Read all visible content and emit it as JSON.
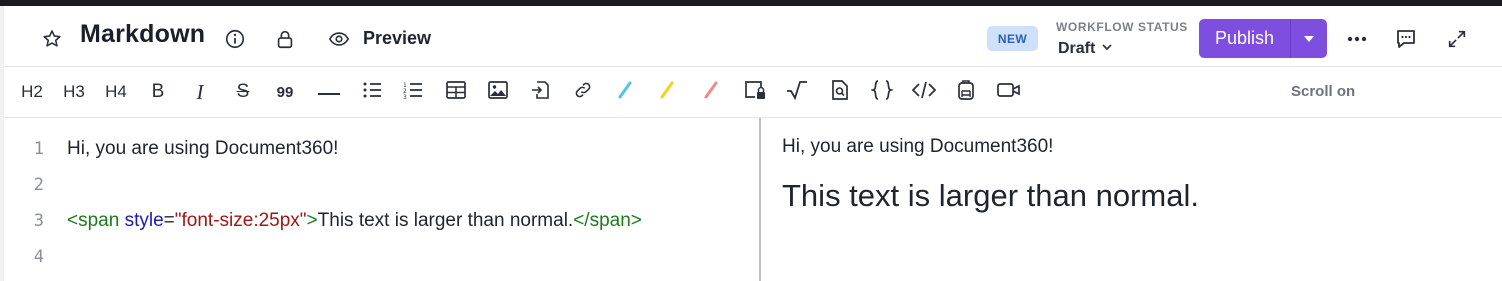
{
  "header": {
    "title": "Markdown",
    "preview_label": "Preview",
    "new_badge": "NEW",
    "workflow_status_label": "WORKFLOW STATUS",
    "workflow_status_value": "Draft",
    "publish_label": "Publish",
    "icons": [
      "star-icon",
      "info-icon",
      "lock-icon",
      "eye-icon",
      "chevron-down-icon",
      "more-icon",
      "comment-icon",
      "expand-icon"
    ]
  },
  "toolbar": {
    "h2": "H2",
    "h3": "H3",
    "h4": "H4",
    "bold": "B",
    "italic": "I",
    "strike": "S",
    "quote": "99",
    "scroll_toggle": "Scroll on"
  },
  "editor": {
    "line_numbers": [
      "1",
      "2",
      "3",
      "4"
    ],
    "line1": "Hi, you are using Document360!",
    "line3": {
      "tag_open_start": "<span",
      "attr_name": "style",
      "equals": "=",
      "attr_value": "\"font-size:25px\"",
      "tag_open_end": ">",
      "text": "This text is larger than normal.",
      "tag_close": "</span>"
    }
  },
  "preview": {
    "line1": "Hi, you are using Document360!",
    "line2": "This text is larger than normal."
  },
  "colors": {
    "brand_purple": "#7d4ee0",
    "badge_blue": "#cfe0fb",
    "tag_green": "#1d7a1d",
    "attr_blue": "#1b1bb3",
    "string_red": "#a31515"
  }
}
